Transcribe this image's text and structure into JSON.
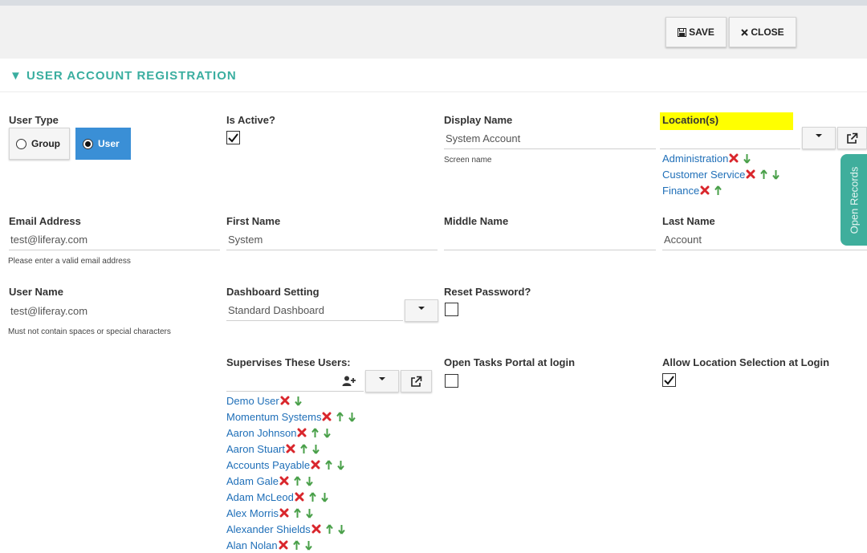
{
  "toolbar": {
    "save_label": "SAVE",
    "close_label": "CLOSE"
  },
  "section": {
    "title": "USER ACCOUNT REGISTRATION"
  },
  "user_type": {
    "label": "User Type",
    "options": [
      "Group",
      "User"
    ],
    "selected": "User"
  },
  "is_active": {
    "label": "Is Active?",
    "checked": true
  },
  "display_name": {
    "label": "Display Name",
    "value": "System Account",
    "hint": "Screen name"
  },
  "locations": {
    "label": "Location(s)",
    "items": [
      {
        "name": "Administration",
        "up": false,
        "down": true
      },
      {
        "name": "Customer Service",
        "up": true,
        "down": true
      },
      {
        "name": "Finance",
        "up": true,
        "down": false
      }
    ]
  },
  "email": {
    "label": "Email Address",
    "value": "test@liferay.com",
    "hint": "Please enter a valid email address"
  },
  "first_name": {
    "label": "First Name",
    "value": "System"
  },
  "middle_name": {
    "label": "Middle Name",
    "value": ""
  },
  "last_name": {
    "label": "Last Name",
    "value": "Account"
  },
  "user_name": {
    "label": "User Name",
    "value": "test@liferay.com",
    "hint": "Must not contain spaces or special characters"
  },
  "dashboard": {
    "label": "Dashboard Setting",
    "value": "Standard Dashboard"
  },
  "reset_password": {
    "label": "Reset Password?",
    "checked": false
  },
  "supervises": {
    "label": "Supervises These Users:",
    "items": [
      {
        "name": "Demo User",
        "up": false,
        "down": true
      },
      {
        "name": "Momentum Systems",
        "up": true,
        "down": true
      },
      {
        "name": "Aaron Johnson",
        "up": true,
        "down": true
      },
      {
        "name": "Aaron Stuart",
        "up": true,
        "down": true
      },
      {
        "name": "Accounts Payable",
        "up": true,
        "down": true
      },
      {
        "name": "Adam Gale",
        "up": true,
        "down": true
      },
      {
        "name": "Adam McLeod",
        "up": true,
        "down": true
      },
      {
        "name": "Alex Morris",
        "up": true,
        "down": true
      },
      {
        "name": "Alexander Shields",
        "up": true,
        "down": true
      },
      {
        "name": "Alan Nolan",
        "up": true,
        "down": true
      }
    ]
  },
  "open_tasks": {
    "label": "Open Tasks Portal at login",
    "checked": false
  },
  "allow_location": {
    "label": "Allow Location Selection at Login",
    "checked": true
  },
  "side_tab": {
    "label": "Open Records"
  },
  "colors": {
    "accent": "#3aaea0",
    "link": "#1f6fb8",
    "highlight": "#ffff00",
    "primary_button": "#3a8fd6"
  }
}
